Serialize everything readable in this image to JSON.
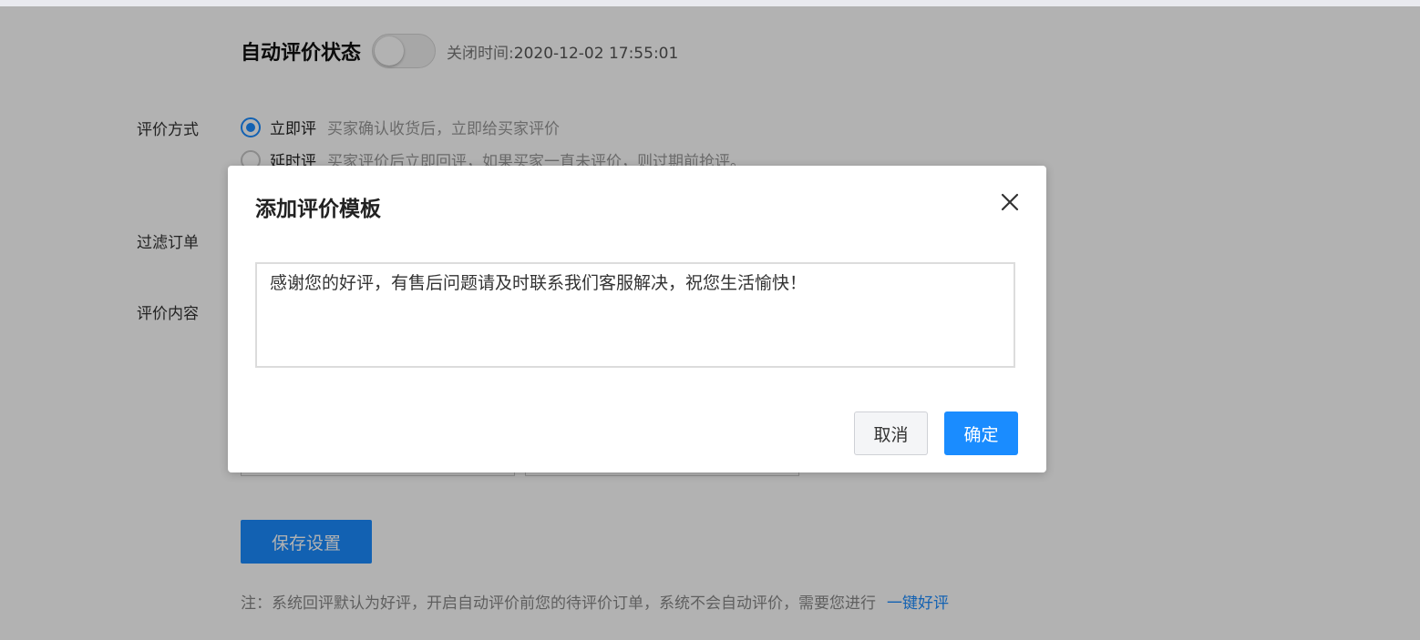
{
  "page": {
    "title": "自动评价状态",
    "toggle_state": "off",
    "close_time_label": "关闭时间:",
    "close_time_value": "2020-12-02 17:55:01",
    "eval_method_label": "评价方式",
    "option_immediate": {
      "label": "立即评",
      "desc": "买家确认收货后，立即给买家评价",
      "checked": true
    },
    "option_delayed": {
      "label": "延时评",
      "desc": "买家评价后立即回评，如果买家一直未评价，则过期前抢评。",
      "checked": false
    },
    "filter_orders_label": "过滤订单",
    "eval_content_label": "评价内容",
    "save_button": "保存设置",
    "note_text": "注：系统回评默认为好评，开启自动评价前您的待评价订单，系统不会自动评价，需要您进行",
    "note_link": "一键好评"
  },
  "modal": {
    "title": "添加评价模板",
    "textarea_value": "感谢您的好评，有售后问题请及时联系我们客服解决，祝您生活愉快！",
    "cancel_label": "取消",
    "confirm_label": "确定",
    "close_icon": "close-icon"
  },
  "colors": {
    "accent": "#1a8cff",
    "overlay": "rgba(0,0,0,0.30)"
  }
}
